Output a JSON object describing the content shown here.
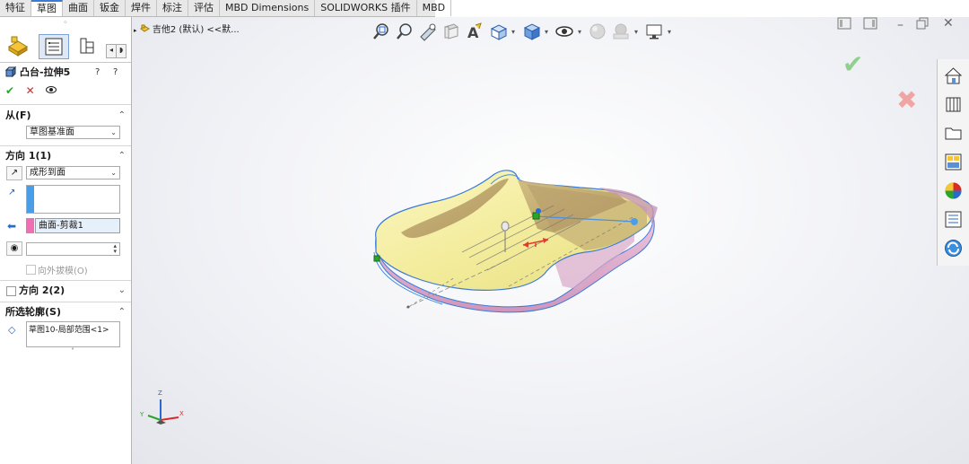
{
  "tabs": [
    "特征",
    "草图",
    "曲面",
    "钣金",
    "焊件",
    "标注",
    "评估",
    "MBD Dimensions",
    "SOLIDWORKS 插件",
    "MBD"
  ],
  "active_tab": "草图",
  "feature": {
    "title": "凸台-拉伸5",
    "help_icons": [
      "?",
      "?"
    ]
  },
  "actions": {
    "ok": "✔",
    "cancel": "✕",
    "preview": "👁"
  },
  "from_section": {
    "header": "从(F)",
    "combo": "草图基准面"
  },
  "dir1_section": {
    "header": "方向 1(1)",
    "end_condition": "成形到面",
    "face_selection": "曲面-剪裁1",
    "draft_label": "向外拔模(O)"
  },
  "dir2_section": {
    "header": "方向 2(2)"
  },
  "contours_section": {
    "header": "所选轮廓(S)",
    "item": "草图10-局部范围<1>"
  },
  "viewport": {
    "tree_label": "吉他2 (默认) <<默..."
  },
  "triad": {
    "x": "X",
    "y": "Y",
    "z": "Z"
  },
  "colors": {
    "accept": "#2aa52a",
    "reject": "#d92a2a",
    "body_yellow": "#f5f0a6",
    "body_pink": "#e6b7d6",
    "highlight": "#4a8fe0",
    "selection_pink": "#ef6fb2",
    "selection_blue": "#4a9ee8"
  }
}
